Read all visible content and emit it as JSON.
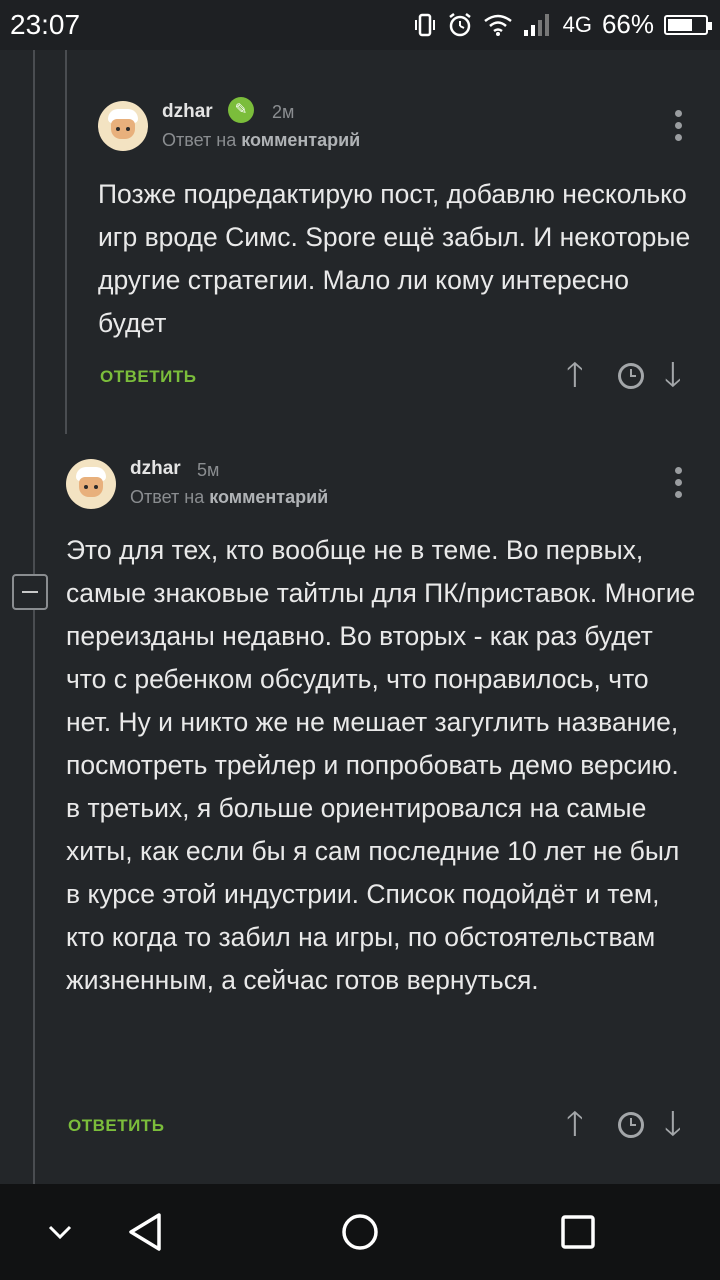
{
  "status_bar": {
    "time": "23:07",
    "network": "4G",
    "battery": "66%",
    "battery_level": 0.66,
    "icons": [
      "vibrate-icon",
      "alarm-icon",
      "wifi-icon",
      "signal-icon",
      "battery-icon"
    ]
  },
  "comments": [
    {
      "username": "dzhar",
      "verified": true,
      "time": "2м",
      "reply_prefix": "Ответ на",
      "reply_target": "комментарий",
      "text": "Позже подредактирую пост, добавлю несколько игр вроде Симс. Spore ещё забыл. И некоторые другие стратегии. Мало ли кому интересно будет",
      "reply_label": "ОТВЕТИТЬ"
    },
    {
      "username": "dzhar",
      "verified": false,
      "time": "5м",
      "reply_prefix": "Ответ на",
      "reply_target": "комментарий",
      "text": "Это для тех, кто вообще не в теме. Во первых, самые знаковые тайтлы для ПК/приставок. Многие переизданы недавно. Во вторых - как раз будет что с ребенком обсудить, что понравилось, что нет. Ну и никто же не мешает загуглить название, посмотреть трейлер и попробовать демо версию.\nв третьих, я больше ориентировался на самые хиты, как если бы я сам последние 10 лет не был в курсе этой индустрии. Список подойдёт и тем, кто когда то забил на игры, по обстоятельствам жизненным, а сейчас готов вернуться.",
      "reply_label": "ОТВЕТИТЬ"
    }
  ],
  "colors": {
    "background": "#232629",
    "accent_green": "#7bbd3b",
    "muted_text": "#8a8d90"
  }
}
